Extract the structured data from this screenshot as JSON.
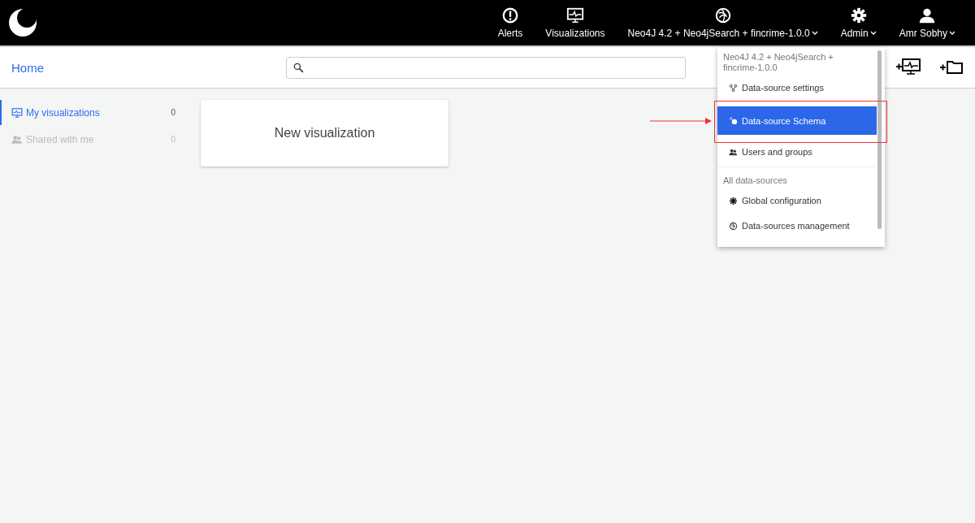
{
  "top_nav": [
    {
      "kind": "alert",
      "label": "Alerts"
    },
    {
      "kind": "monitor",
      "label": "Visualizations"
    },
    {
      "kind": "globe",
      "label": "Neo4J 4.2 + Neo4jSearch + fincrime-1.0.0",
      "caret": true
    },
    {
      "kind": "gear",
      "label": "Admin",
      "caret": true
    },
    {
      "kind": "user",
      "label": "Amr Sobhy",
      "caret": true
    }
  ],
  "header": {
    "title": "Home"
  },
  "sidebar": {
    "items": [
      {
        "kind": "monitor",
        "label": "My visualizations",
        "count": "0",
        "selected": true
      },
      {
        "kind": "users",
        "label": "Shared with me",
        "count": "0",
        "selected": false
      }
    ]
  },
  "card": {
    "label": "New visualization"
  },
  "admin_menu": {
    "sections": [
      {
        "heading": "Neo4J 4.2 + Neo4jSearch + fincrime-1.0.0",
        "items": [
          {
            "kind": "nodes",
            "label": "Data-source settings",
            "selected": false
          },
          {
            "kind": "schema",
            "label": "Data-source Schema",
            "selected": true
          },
          {
            "kind": "users",
            "label": "Users and groups",
            "selected": false
          }
        ]
      },
      {
        "heading": "All data-sources",
        "items": [
          {
            "kind": "gear",
            "label": "Global configuration",
            "selected": false
          },
          {
            "kind": "globe",
            "label": "Data-sources management",
            "selected": false
          }
        ]
      }
    ]
  }
}
